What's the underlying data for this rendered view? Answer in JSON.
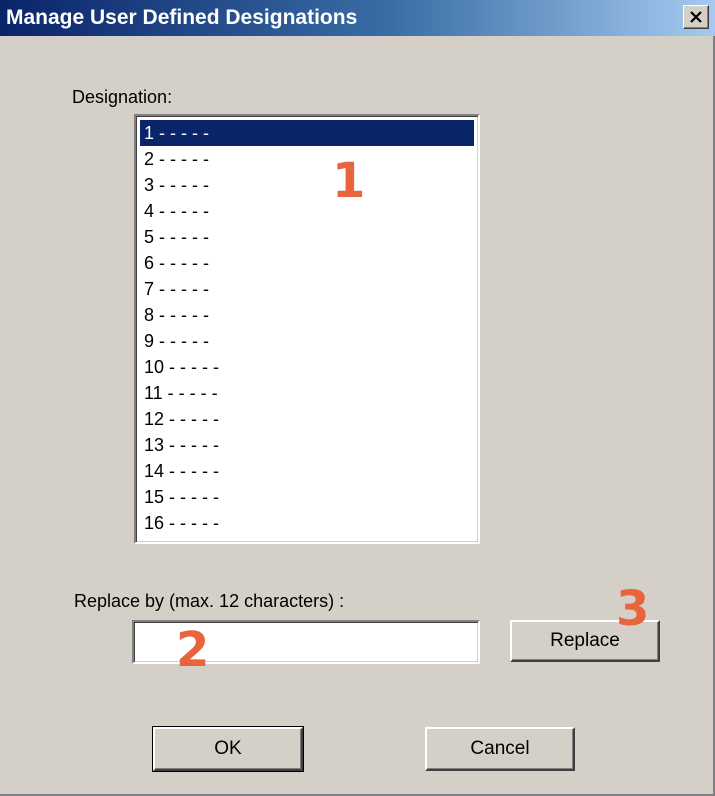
{
  "window": {
    "title": "Manage User Defined Designations",
    "close_icon": "close-icon"
  },
  "designation": {
    "label": "Designation:",
    "items": [
      {
        "label": "1 - - - - -"
      },
      {
        "label": "2 - - - - -"
      },
      {
        "label": "3 - - - - -"
      },
      {
        "label": "4 - - - - -"
      },
      {
        "label": "5 - - - - -"
      },
      {
        "label": "6 - - - - -"
      },
      {
        "label": "7 - - - - -"
      },
      {
        "label": "8 - - - - -"
      },
      {
        "label": "9 - - - - -"
      },
      {
        "label": "10 - - - - -"
      },
      {
        "label": "11 - - - - -"
      },
      {
        "label": "12 - - - - -"
      },
      {
        "label": "13 - - - - -"
      },
      {
        "label": "14 - - - - -"
      },
      {
        "label": "15 - - - - -"
      },
      {
        "label": "16 - - - - -"
      }
    ],
    "selected_index": 0
  },
  "replace": {
    "label": "Replace by (max. 12 characters) :",
    "value": "",
    "button_label": "Replace"
  },
  "footer": {
    "ok_label": "OK",
    "cancel_label": "Cancel"
  },
  "annotations": {
    "one": "1",
    "two": "2",
    "three": "3",
    "color": "#e8643c"
  },
  "colors": {
    "titlebar_start": "#0a246a",
    "titlebar_end": "#a6caf0",
    "selection": "#0a246a",
    "dialog_bg": "#d4d0c8"
  }
}
